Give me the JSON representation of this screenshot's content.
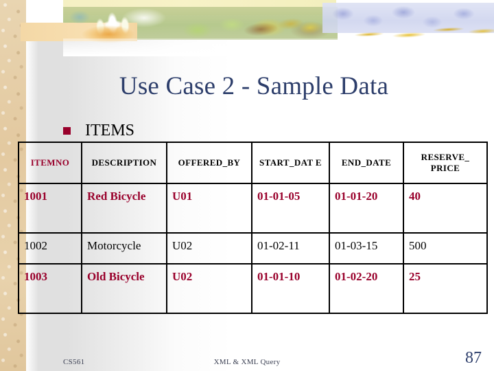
{
  "slide": {
    "title": "Use Case 2 - Sample Data",
    "bullet": {
      "marker": "square-bullet",
      "label": "ITEMS"
    }
  },
  "colors": {
    "title": "#2d3e6b",
    "accent_maroon": "#99002b",
    "text": "#000000",
    "footer": "#3a3f52",
    "left_strip": "#e6cfa8"
  },
  "table": {
    "name": "ITEMS",
    "headers": [
      "ITEMNO",
      "DESCRIPTION",
      "OFFERED_BY",
      "START_DAT E",
      "END_DATE",
      "RESERVE_ PRICE"
    ],
    "rows": [
      {
        "highlight": true,
        "cells": [
          "1001",
          "Red Bicycle",
          "U01",
          "01-01-05",
          "01-01-20",
          "40"
        ]
      },
      {
        "highlight": false,
        "cells": [
          "1002",
          "Motorcycle",
          "U02",
          "01-02-11",
          "01-03-15",
          "500"
        ]
      },
      {
        "highlight": true,
        "cells": [
          "1003",
          "Old Bicycle",
          "U02",
          "01-01-10",
          "01-02-20",
          "25"
        ]
      }
    ]
  },
  "footer": {
    "course": "CS561",
    "center": "XML & XML Query",
    "page": "87"
  }
}
